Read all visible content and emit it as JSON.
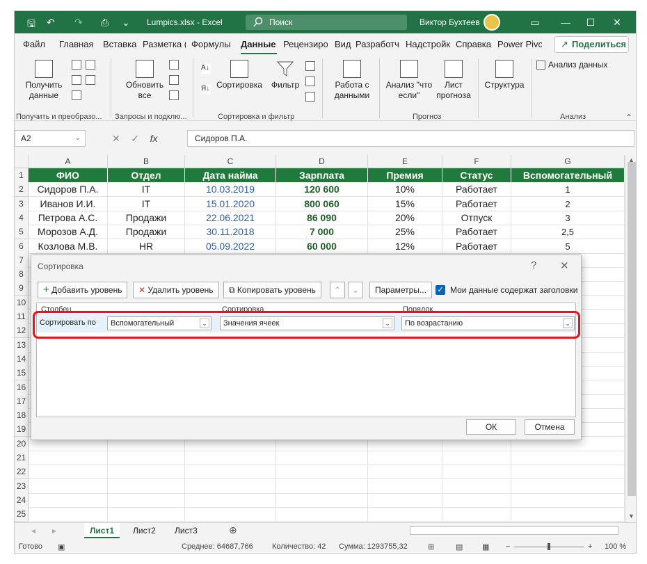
{
  "window": {
    "file_name": "Lumpics.xlsx - Excel",
    "search_placeholder": "Поиск",
    "user_name": "Виктор Бухтеев"
  },
  "ribbon_tabs": [
    "Файл",
    "Главная",
    "Вставка",
    "Разметка (",
    "Формулы",
    "Данные",
    "Рецензиро",
    "Вид",
    "Разработч",
    "Надстройк",
    "Справка",
    "Power Pivo"
  ],
  "share_label": "Поделиться",
  "ribbon": {
    "get_data": "Получить данные",
    "refresh_all": "Обновить все",
    "sort_label": "Сортировка",
    "filter_label": "Фильтр",
    "data_tools": "Работа с данными",
    "what_if": "Анализ \"что если\"",
    "forecast_sheet": "Лист прогноза",
    "outline": "Структура",
    "data_analysis": "Анализ данных",
    "groups": [
      "Получить и преобразо...",
      "Запросы и подклю...",
      "Сортировка и фильтр",
      "Прогноз",
      "Анализ"
    ]
  },
  "formula_bar": {
    "name_box": "A2",
    "formula": "Сидоров П.А."
  },
  "columns": [
    "A",
    "B",
    "C",
    "D",
    "E",
    "F",
    "G"
  ],
  "rows": [
    "1",
    "2",
    "3",
    "4",
    "5",
    "6",
    "7",
    "8",
    "9",
    "10",
    "11",
    "12",
    "13",
    "14",
    "15",
    "16",
    "17",
    "18",
    "19",
    "20",
    "21",
    "22",
    "23",
    "24",
    "25"
  ],
  "table": {
    "headers": [
      "ФИО",
      "Отдел",
      "Дата найма",
      "Зарплата",
      "Премия",
      "Статус",
      "Вспомогательный"
    ],
    "rows": [
      [
        "Сидоров П.А.",
        "IT",
        "10.03.2019",
        "120 600",
        "10%",
        "Работает",
        "1"
      ],
      [
        "Иванов И.И.",
        "IT",
        "15.01.2020",
        "800 060",
        "15%",
        "Работает",
        "2"
      ],
      [
        "Петрова А.С.",
        "Продажи",
        "22.06.2021",
        "86 090",
        "20%",
        "Отпуск",
        "3"
      ],
      [
        "Морозов А.Д.",
        "Продажи",
        "30.11.2018",
        "7 000",
        "25%",
        "Работает",
        "2,5"
      ],
      [
        "Козлова М.В.",
        "HR",
        "05.09.2022",
        "60 000",
        "12%",
        "Работает",
        "5"
      ]
    ]
  },
  "dialog": {
    "title": "Сортировка",
    "help": "?",
    "add_level": "Добавить уровень",
    "delete_level": "Удалить уровень",
    "copy_level": "Копировать уровень",
    "options": "Параметры...",
    "has_headers_label": "Мои данные содержат заголовки",
    "has_headers": true,
    "col_header": "Столбец",
    "sort_header": "Сортировка",
    "order_header": "Порядок",
    "sort_by_label": "Сортировать по",
    "column_value": "Вспомогательный",
    "sort_on_value": "Значения ячеек",
    "order_value": "По возрастанию",
    "ok": "ОК",
    "cancel": "Отмена"
  },
  "sheets": [
    "Лист1",
    "Лист2",
    "Лист3"
  ],
  "status": {
    "ready": "Готово",
    "average": "Среднее: 64687,766",
    "count": "Количество: 42",
    "sum": "Сумма: 1293755,32",
    "zoom": "100 %"
  },
  "colors": {
    "excel_green": "#217346",
    "header_fill": "#1f7a3c",
    "highlight_red": "#e8141c"
  }
}
